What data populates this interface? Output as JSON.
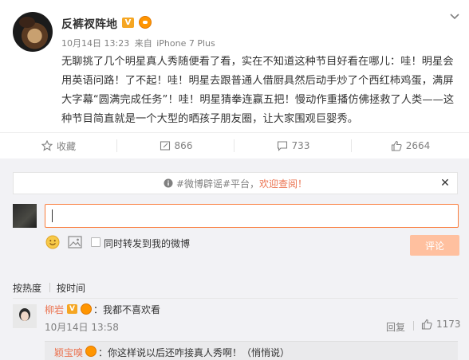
{
  "post": {
    "author": "反裤衩阵地",
    "verified_badge": "V",
    "date": "10月14日 13:23",
    "from": "来自",
    "device": "iPhone 7 Plus",
    "text": "无聊挑了几个明星真人秀随便看了看，实在不知道这种节目好看在哪儿：哇！明星会用英语问路！了不起！哇！明星去跟普通人借厨具然后动手炒了个西红柿鸡蛋，满屏大字幕“圆满完成任务”！哇！明星猜拳连赢五把！慢动作重播仿佛拯救了人类——这种节目简直就是一个大型的晒孩子朋友圈，让大家围观巨婴秀。"
  },
  "actions": {
    "favorite": "收藏",
    "repost": "866",
    "comment": "733",
    "like": "2664"
  },
  "notice": {
    "tag": "#微博辟谣#平台，",
    "link": "欢迎查阅！"
  },
  "composer": {
    "repost_label": "同时转发到我的微博",
    "submit": "评论"
  },
  "sort": {
    "hot": "按热度",
    "time": "按时间"
  },
  "comment": {
    "name": "柳岩",
    "verified_badge": "V",
    "text": "：我都不喜欢看",
    "date": "10月14日 13:58",
    "reply": "回复",
    "likes": "1173"
  },
  "sub_reply": {
    "name": "颖宝嗅",
    "text": "：你这样说以后还咋接真人秀啊！（悄悄说）"
  },
  "colors": {
    "accent": "#eb7350",
    "input_border": "#fa7d3c",
    "submit_disabled": "#ffc09f",
    "badge": "#f5a623"
  }
}
